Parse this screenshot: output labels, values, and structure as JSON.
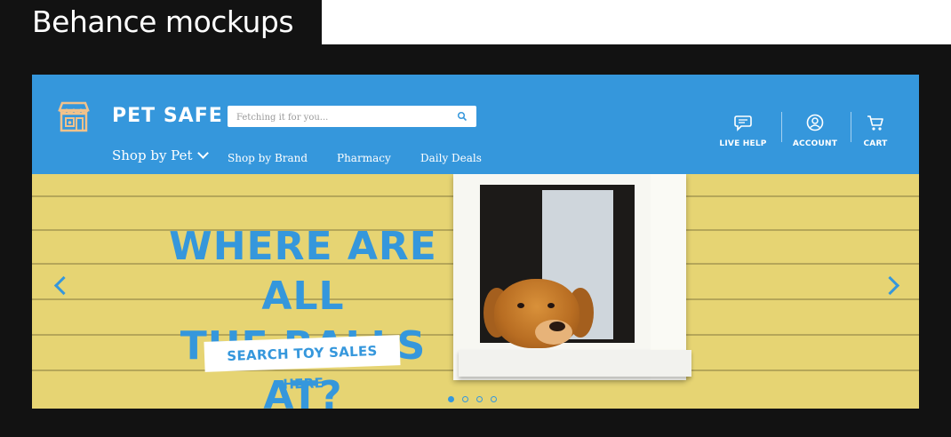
{
  "caption": "Behance mockups",
  "header": {
    "brand": "PET SAFE",
    "search_placeholder": "Fetching it for you...",
    "nav": {
      "shop_by_pet": "Shop by Pet",
      "items": [
        "Shop by Brand",
        "Pharmacy",
        "Daily Deals"
      ]
    },
    "utilities": [
      {
        "label": "LIVE HELP",
        "icon": "chat-bubble-icon"
      },
      {
        "label": "ACCOUNT",
        "icon": "user-icon"
      },
      {
        "label": "CART",
        "icon": "cart-icon"
      }
    ]
  },
  "hero": {
    "headline": "WHERE ARE ALL\nTHE BALLS AT?",
    "cta": "SEARCH TOY SALES HERE",
    "slides": 4,
    "active_slide": 1
  },
  "colors": {
    "brand_blue": "#3597dc",
    "logo_accent": "#f2c28b",
    "background": "#121212"
  }
}
